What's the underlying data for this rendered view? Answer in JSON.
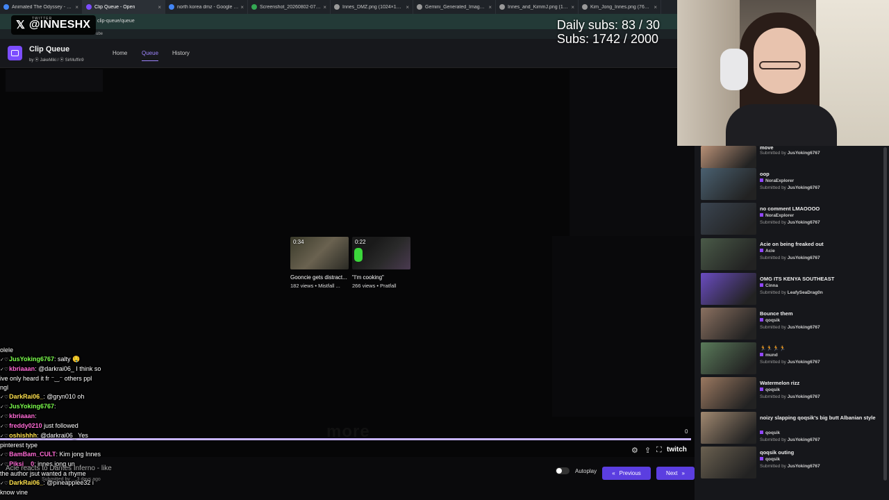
{
  "browser": {
    "tabs": [
      {
        "title": "Animated The Odyssey - Googl",
        "color": "#4285f4"
      },
      {
        "title": "Clip Queue - Open",
        "color": "#7c4dff",
        "active": true
      },
      {
        "title": "north korea dmz - Google Sear",
        "color": "#4285f4"
      },
      {
        "title": "Screenshot_20260802-071502...",
        "color": "#34a853"
      },
      {
        "title": "Innes_DMZ.png (1024×1040)",
        "color": "#999999"
      },
      {
        "title": "Gemini_Generated_Image_xz5...",
        "color": "#999999"
      },
      {
        "title": "Innes_and_KimmJ.png (1462×1...",
        "color": "#999999"
      },
      {
        "title": "Kim_Jong_Innes.png (768×130...",
        "color": "#999999"
      }
    ],
    "url": "clip-queue/queue",
    "bookmark": "ube"
  },
  "overlay": {
    "twitter_small": "TWITTER",
    "twitter_handle": "@INNESHX",
    "twitter_x": "𝕏",
    "daily_subs": "Daily subs: 83 / 30",
    "subs": "Subs: 1742 / 2000"
  },
  "app": {
    "title": "Clip Queue",
    "credits": "by ⦿ JakeMiki / ⦿ SirMuffin9",
    "nav": {
      "home": "Home",
      "queue": "Queue",
      "history": "History"
    }
  },
  "clips": [
    {
      "duration": "0:34",
      "title": "Gooncie gets distract...",
      "meta": "182 views • Mistfall ..."
    },
    {
      "duration": "0:22",
      "title": "\"I'm cooking\"",
      "meta": "266 views • Pratfall"
    }
  ],
  "player": {
    "more_text": "more",
    "progress_count": "0",
    "autoplay_label": "Autoplay",
    "previous_label": "Previous",
    "next_label": "Next",
    "twitch_label": "twitch"
  },
  "chat": [
    {
      "user": "",
      "text": "olele",
      "color": "#ffffff"
    },
    {
      "user": "JusYoking6767",
      "text": ": salty 🤤",
      "color": "#7cff4d"
    },
    {
      "user": "kbriaaan",
      "text": ": @darkrai06_ I think so",
      "color": "#ff6ad5"
    },
    {
      "user": "",
      "text": "ive only heard it fr ⁻‿⁻ others ppl",
      "color": "#ffffff"
    },
    {
      "user": "",
      "text": "ngl",
      "color": "#ffffff"
    },
    {
      "user": "DarkRai06_",
      "text": ": @gryn010 oh",
      "color": "#ffe14d"
    },
    {
      "user": "JusYoking6767",
      "text": ":",
      "color": "#7cff4d"
    },
    {
      "user": "kbriaaan",
      "text": ":",
      "color": "#ff6ad5"
    },
    {
      "user": "freddy0210",
      "text": " just followed",
      "color": "#ff6ad5"
    },
    {
      "user": "oshishhh",
      "text": ": @darkrai06_ Yes",
      "color": "#ffe14d"
    },
    {
      "user": "",
      "text": "pinterest type",
      "color": "#ffffff"
    },
    {
      "user": "BamBam_CULT",
      "text": ": Kim jong Innes",
      "color": "#ff6ad5"
    },
    {
      "user": "Piksi__0",
      "text": ": innes jong un",
      "color": "#ff6ad5"
    },
    {
      "user": "",
      "text": "the author jsut wanted a rhyme",
      "color": "#ffffff"
    },
    {
      "user": "DarkRai06_",
      "text": ": @pineapplee32 i",
      "color": "#ffe14d"
    },
    {
      "user": "",
      "text": "know vine",
      "color": "#ffffff"
    }
  ],
  "meta_overlay": {
    "title": "Acie reacts to Dantes Inferno - like",
    "subtitle": "Submitted by ... 3 days ago"
  },
  "queue": [
    {
      "title": "move",
      "channel": "",
      "submitter": "JusYoking6767",
      "color": "#b89076"
    },
    {
      "title": "oop",
      "channel": "NoraExplorer",
      "submitter": "JusYoking6767",
      "color": "#4a6070"
    },
    {
      "title": "no comment LMAOOOO",
      "channel": "NoraExplorer",
      "submitter": "JusYoking6767",
      "color": "#3a4450"
    },
    {
      "title": "Acie on being freaked out",
      "channel": "Acie",
      "submitter": "JusYoking6767",
      "color": "#4a5a48"
    },
    {
      "title": "OMG ITS KENYA SOUTHEAST",
      "channel": "Cinna",
      "submitter": "LeafySeaDrag0n",
      "color": "#6a4cc0"
    },
    {
      "title": "Bounce them",
      "channel": "qoqsik",
      "submitter": "JusYoking6767",
      "color": "#8a7060"
    },
    {
      "title": "🏃🏃🏃🏃",
      "channel": "mund",
      "submitter": "JusYoking6767",
      "color": "#5a7a5a"
    },
    {
      "title": "Watermelon rizz",
      "channel": "qoqsik",
      "submitter": "JusYoking6767",
      "color": "#9a7860"
    },
    {
      "title": "noizy slapping qoqsik's big butt Albanian style",
      "channel": "qoqsik",
      "submitter": "JusYoking6767",
      "color": "#a08870"
    },
    {
      "title": "qoqsik outing",
      "channel": "qoqsik",
      "submitter": "JusYoking6767",
      "color": "#6a6050"
    }
  ],
  "queue_submitted_prefix": "Submitted by"
}
